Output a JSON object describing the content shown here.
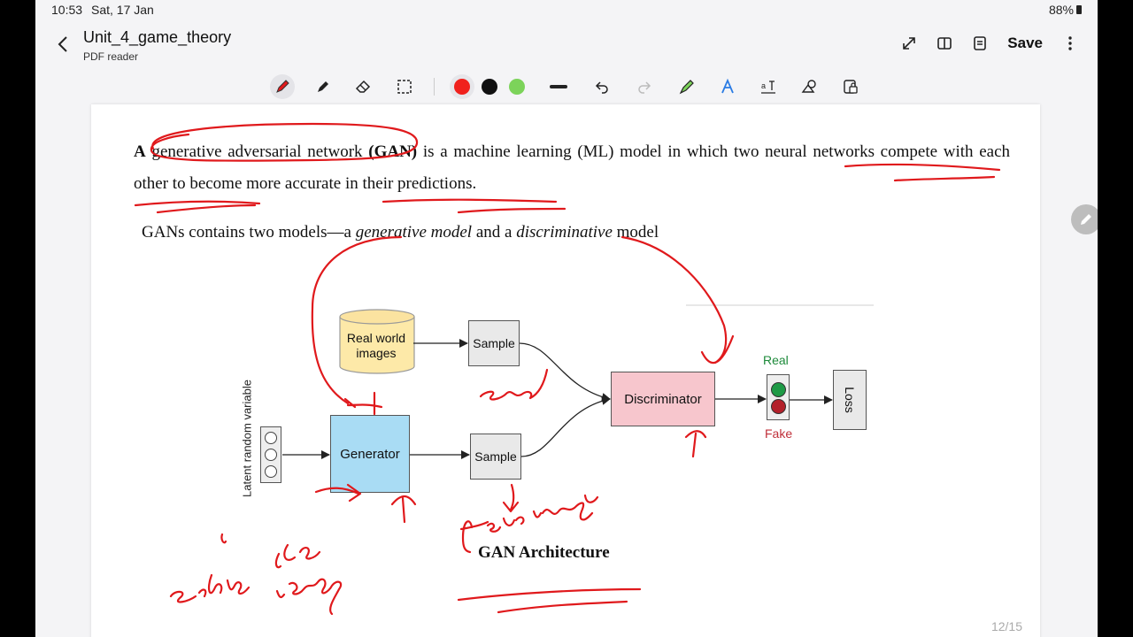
{
  "status": {
    "time": "10:53",
    "date": "Sat, 17 Jan",
    "battery": "88%"
  },
  "appbar": {
    "title": "Unit_4_game_theory",
    "subtitle": "PDF reader",
    "save_label": "Save"
  },
  "toolbar": {
    "tools": [
      "pen-icon",
      "highlighter-icon",
      "eraser-icon",
      "lasso-select-icon"
    ],
    "colors": [
      "#f0211d",
      "#111111",
      "#7cd35a"
    ],
    "active_color": "#f0211d"
  },
  "document": {
    "para_a": "A",
    "para_gan": "generative adversarial network",
    "para_gan_abbr": "(GAN)",
    "para_rest": " is a machine learning (ML) model in which two neural networks compete with each other to become more accurate in their predictions.",
    "line2_a": "GANs contains two models—a ",
    "line2_gen": "generative model",
    "line2_b": " and a ",
    "line2_disc": "discriminative",
    "line2_c": " model",
    "diagram": {
      "db_label": "Real world\nimages",
      "sample_top": "Sample",
      "sample_bottom": "Sample",
      "generator": "Generator",
      "discriminator": "Discriminator",
      "loss": "Loss",
      "real": "Real",
      "fake": "Fake",
      "latent": "Latent random variable",
      "real_color": "#1d8a3a",
      "fake_color": "#c0303a"
    },
    "caption": "GAN Architecture",
    "page_indicator": "12/15"
  },
  "annotations": {
    "ink_color": "#e0191c"
  }
}
